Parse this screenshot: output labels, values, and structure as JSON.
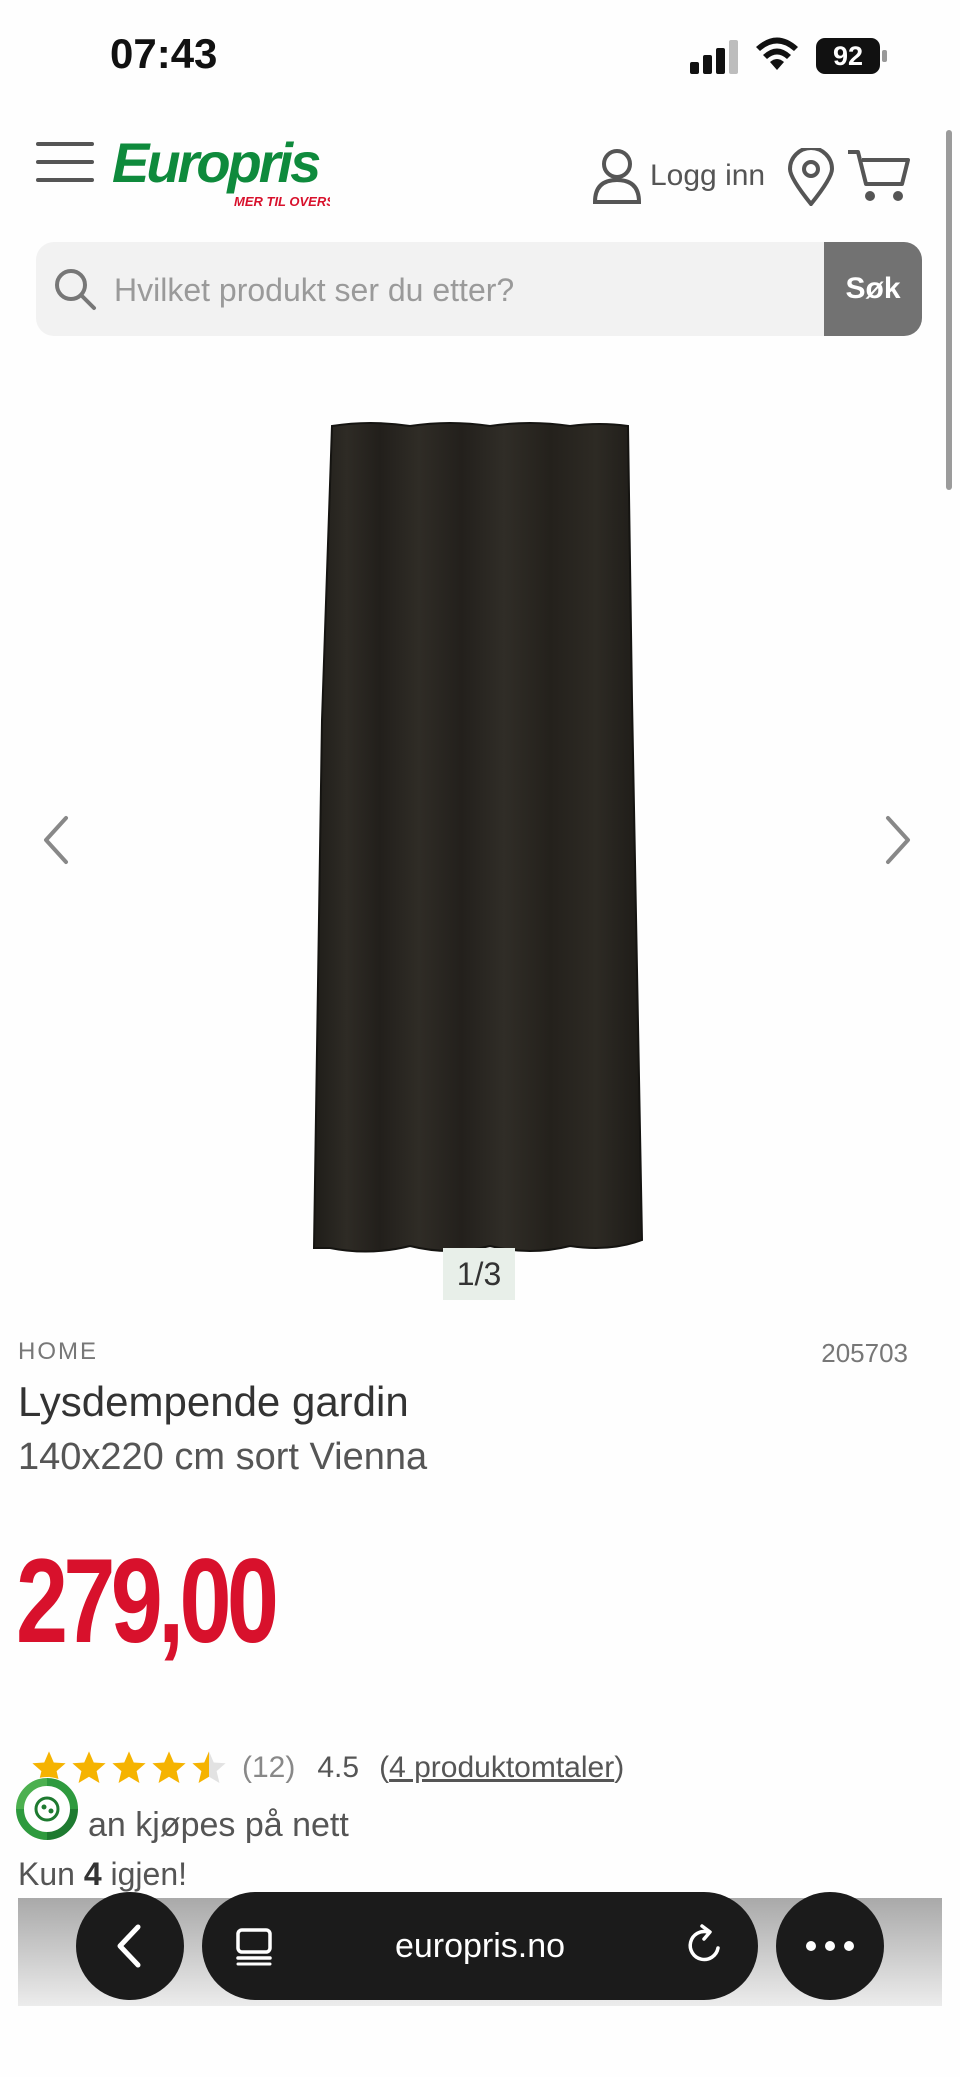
{
  "status": {
    "time": "07:43",
    "battery": "92"
  },
  "header": {
    "logo_text": "Europris",
    "logo_tagline": "MER TIL OVERS",
    "login_label": "Logg inn"
  },
  "search": {
    "placeholder": "Hvilket produkt ser du etter?",
    "button_label": "Søk"
  },
  "gallery": {
    "counter": "1/3"
  },
  "product": {
    "category": "HOME",
    "sku": "205703",
    "title": "Lysdempende gardin",
    "subtitle": "140x220 cm sort Vienna",
    "price": "279,00",
    "rating_count": "(12)",
    "rating_value": "4.5",
    "rating": 4.5,
    "reviews_prefix": "(",
    "reviews_link": "4 produktomtaler",
    "reviews_suffix": ")",
    "availability": "an kjøpes på nett",
    "stock_prefix": "Kun ",
    "stock_count": "4",
    "stock_suffix": " igjen!"
  },
  "browser": {
    "url": "europris.no"
  },
  "colors": {
    "brand_green": "#0e8a3c",
    "price_red": "#d8112c",
    "star_yellow": "#f5b301"
  }
}
